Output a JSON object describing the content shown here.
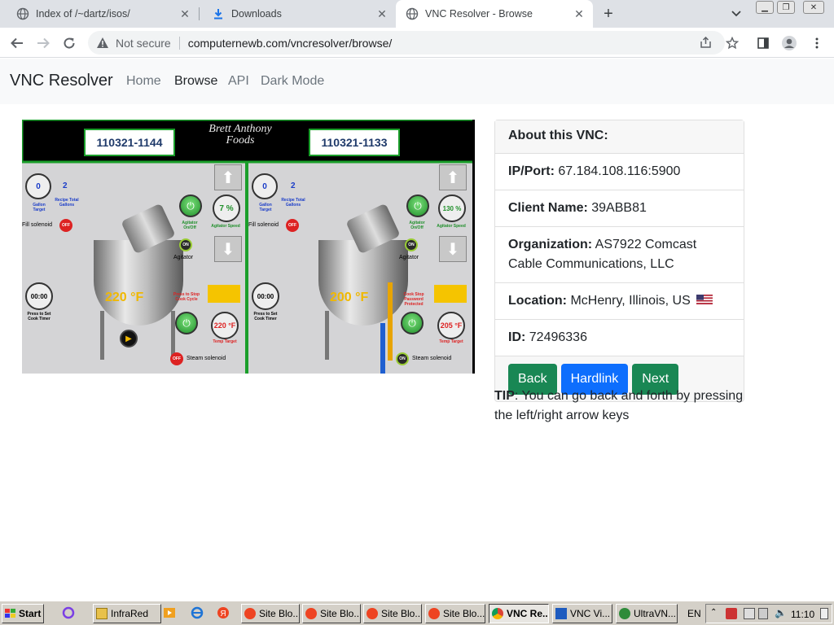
{
  "browser": {
    "tabs": [
      {
        "title": "Index of /~dartz/isos/",
        "icon": "globe-icon",
        "active": false
      },
      {
        "title": "Downloads",
        "icon": "download-icon",
        "active": false
      },
      {
        "title": "VNC Resolver - Browse",
        "icon": "globe-icon",
        "active": true
      }
    ],
    "address": {
      "security_label": "Not secure",
      "url": "computernewb.com/vncresolver/browse/"
    }
  },
  "site": {
    "brand": "VNC Resolver",
    "nav": [
      {
        "label": "Home",
        "active": false
      },
      {
        "label": "Browse",
        "active": true
      },
      {
        "label": "API",
        "active": false
      },
      {
        "label": "Dark Mode",
        "active": false
      }
    ]
  },
  "vnc_screen": {
    "left_panel": {
      "batch_id": "110321-1144",
      "gallon_target": "0",
      "recipe_total": "2",
      "gallon_target_label": "Gallon Target",
      "recipe_total_label": "Recipe Total Gallons",
      "fill_solenoid_label": "Fill solenoid",
      "fill_state": "OFF",
      "agitator_onoff_label": "Agitator On/Off",
      "agitator_speed": "7 %",
      "agitator_speed_label": "Agitator Speed",
      "agitator_state": "ON",
      "agitator_label": "Agitator",
      "cook_timer": "00:00",
      "cook_timer_label": "Press to Set Cook Timer",
      "temperature": "220 °F",
      "stop_cook_label": "Press to Stop Cook Cycle",
      "temp_target": "220 °F",
      "temp_target_label": "Temp Target",
      "steam_state": "OFF",
      "steam_label": "Steam solenoid"
    },
    "right_panel": {
      "batch_id": "110321-1133",
      "gallon_target": "0",
      "recipe_total": "2",
      "gallon_target_label": "Gallon Target",
      "recipe_total_label": "Recipe Total Gallons",
      "fill_solenoid_label": "Fill solenoid",
      "fill_state": "OFF",
      "agitator_onoff_label": "Agitator On/Off",
      "agitator_speed": "130 %",
      "agitator_speed_label": "Agitator Speed",
      "agitator_state": "ON",
      "agitator_label": "Agitator",
      "cook_timer": "00:00",
      "cook_timer_label": "Press to Set Cook Timer",
      "temperature": "200 °F",
      "stop_cook_label": "Cook Stop Password Protected",
      "temp_target": "205 °F",
      "temp_target_label": "Temp Target",
      "steam_state": "ON",
      "steam_label": "Steam solenoid"
    },
    "logo_text": "Brett Anthony Foods"
  },
  "about": {
    "title": "About this VNC:",
    "ip_label": "IP/Port:",
    "ip_value": "67.184.108.116:5900",
    "client_label": "Client Name:",
    "client_value": "39ABB81",
    "org_label": "Organization:",
    "org_value": "AS7922 Comcast Cable Communications, LLC",
    "location_label": "Location:",
    "location_value": "McHenry, Illinois, US",
    "id_label": "ID:",
    "id_value": "72496336",
    "buttons": {
      "back": "Back",
      "hardlink": "Hardlink",
      "next": "Next"
    },
    "colors": {
      "green": "#198754",
      "blue": "#0d6efd"
    }
  },
  "tip": {
    "label": "TIP",
    "text": ": You can go back and forth by pressing the left/right arrow keys"
  },
  "taskbar": {
    "start": "Start",
    "items": [
      {
        "label": "InfraRed"
      },
      {
        "label": "Site Blo..."
      },
      {
        "label": "Site Blo..."
      },
      {
        "label": "Site Blo..."
      },
      {
        "label": "Site Blo..."
      },
      {
        "label": "VNC Re..."
      },
      {
        "label": "VNC Vi..."
      },
      {
        "label": "UltraVN..."
      }
    ],
    "lang": "EN",
    "clock": "11:10"
  }
}
